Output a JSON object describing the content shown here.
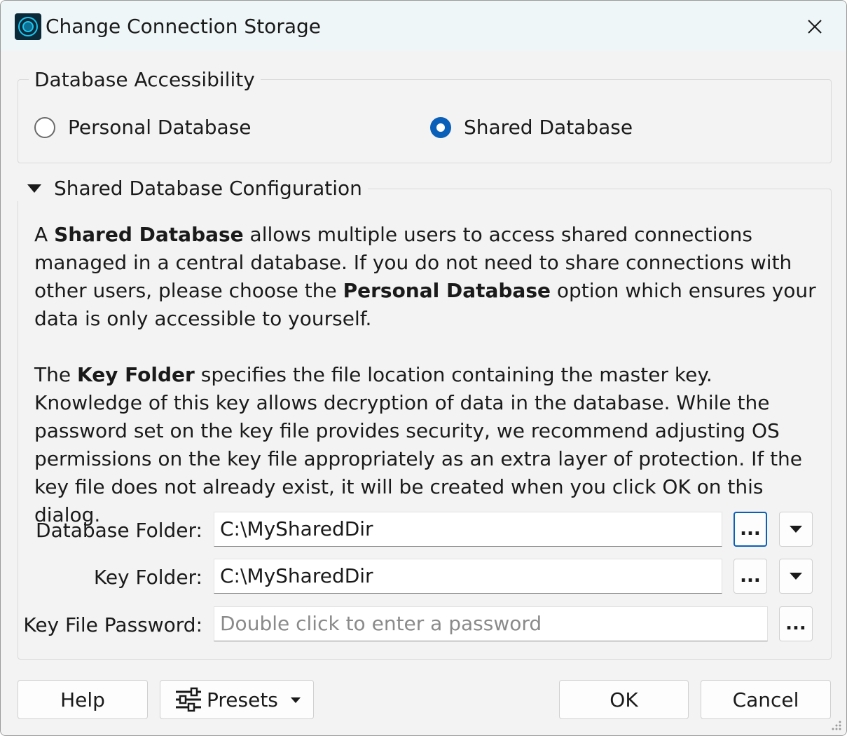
{
  "window": {
    "title": "Change Connection Storage",
    "app_icon": "app-logo-icon",
    "close_icon": "close-icon"
  },
  "accessibility": {
    "legend": "Database Accessibility",
    "options": [
      {
        "label": "Personal Database",
        "checked": false
      },
      {
        "label": "Shared Database",
        "checked": true
      }
    ]
  },
  "shared_config": {
    "legend": "Shared Database Configuration",
    "expanded": true,
    "para1": {
      "p1": "A ",
      "b1": "Shared Database",
      "p2": " allows multiple users to access shared connections managed in a central database. If you do not need to share connections with other users, please choose the ",
      "b2": "Personal Database",
      "p3": " option which ensures your data is only accessible to yourself."
    },
    "para2": {
      "p1": "The ",
      "b1": "Key Folder",
      "p2": " specifies the file location containing the master key. Knowledge of this key allows decryption of data in the database. While the password set on the key file provides security, we recommend adjusting OS permissions on the key file appropriately as an extra layer of protection. If the key file does not already exist, it will be created when you click OK on this dialog."
    },
    "fields": {
      "database_folder": {
        "label": "Database Folder:",
        "value": "C:\\MySharedDir",
        "browse_label": "..."
      },
      "key_folder": {
        "label": "Key Folder:",
        "value": "C:\\MySharedDir",
        "browse_label": "..."
      },
      "key_file_password": {
        "label": "Key File Password:",
        "value": "",
        "placeholder": "Double click to enter a password",
        "browse_label": "..."
      }
    }
  },
  "footer": {
    "help_label": "Help",
    "presets_label": "Presets",
    "ok_label": "OK",
    "cancel_label": "Cancel"
  },
  "colors": {
    "accent": "#0a5fb8",
    "titlebar_bg": "#eef6f8",
    "dialog_bg": "#f3f3f3"
  }
}
